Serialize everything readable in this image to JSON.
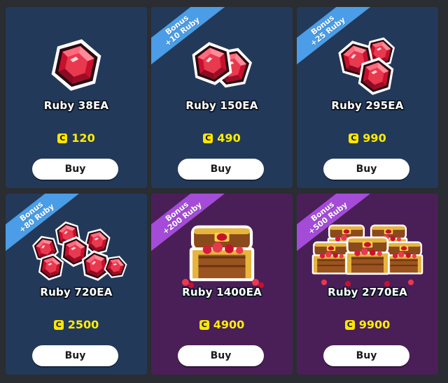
{
  "coin_symbol": "C",
  "colors": {
    "ruby_card_bg": "#23395a",
    "chest_card_bg": "#4a1f58",
    "ribbon_blue": "#4a9de6",
    "ribbon_purple": "#a44bd8",
    "price_yellow": "#ffee00"
  },
  "items": [
    {
      "title": "Ruby 38EA",
      "price": "120",
      "buy_label": "Buy",
      "icon": "single-ruby-icon"
    },
    {
      "title": "Ruby 150EA",
      "price": "490",
      "buy_label": "Buy",
      "bonus_line1": "Bonus",
      "bonus_line2": "+10 Ruby",
      "icon": "two-rubies-icon"
    },
    {
      "title": "Ruby 295EA",
      "price": "990",
      "buy_label": "Buy",
      "bonus_line1": "Bonus",
      "bonus_line2": "+25 Ruby",
      "icon": "three-rubies-icon"
    },
    {
      "title": "Ruby 720EA",
      "price": "2500",
      "buy_label": "Buy",
      "bonus_line1": "Bonus",
      "bonus_line2": "+80 Ruby",
      "icon": "ruby-pile-icon"
    },
    {
      "title": "Ruby 1400EA",
      "price": "4900",
      "buy_label": "Buy",
      "bonus_line1": "Bonus",
      "bonus_line2": "+200 Ruby",
      "icon": "treasure-chest-icon"
    },
    {
      "title": "Ruby 2770EA",
      "price": "9900",
      "buy_label": "Buy",
      "bonus_line1": "Bonus",
      "bonus_line2": "+500 Ruby",
      "icon": "treasure-chests-icon"
    }
  ]
}
